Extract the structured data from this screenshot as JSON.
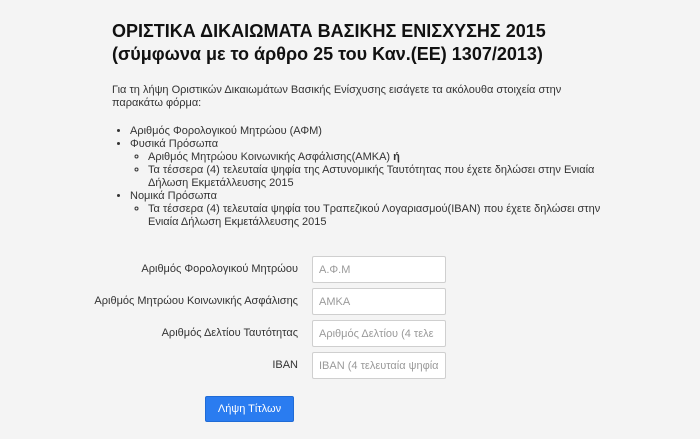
{
  "header": {
    "title_line1": "ΟΡΙΣΤΙΚΑ ΔΙΚΑΙΩΜΑΤΑ ΒΑΣΙΚΗΣ ΕΝΙΣΧΥΣΗΣ 2015",
    "title_line2": "(σύμφωνα με το άρθρο 25 του Καν.(ΕΕ) 1307/2013)"
  },
  "intro": {
    "text": "Για τη λήψη Οριστικών Δικαιωμάτων Βασικής Ενίσχυσης εισάγετε τα ακόλουθα στοιχεία στην παρακάτω φόρμα:"
  },
  "requirements": {
    "afm": "Αριθμός Φορολογικού Μητρώου (ΑΦΜ)",
    "natural_persons": {
      "label": "Φυσικά Πρόσωπα",
      "amka_text": "Αριθμός Μητρώου Κοινωνικής Ασφάλισης(ΑΜΚΑ)",
      "or_text": "ή",
      "id_card_text": "Τα τέσσερα (4) τελευταία ψηφία της Αστυνομικής Ταυτότητας που έχετε δηλώσει στην Ενιαία Δήλωση Εκμετάλλευσης 2015"
    },
    "legal_persons": {
      "label": "Νομικά Πρόσωπα",
      "iban_text": "Τα τέσσερα (4) τελευταία ψηφία του Τραπεζικού Λογαριασμού(IBAN) που έχετε δηλώσει στην Ενιαία Δήλωση Εκμετάλλευσης 2015"
    }
  },
  "form": {
    "afm": {
      "label": "Αριθμός Φορολογικού Μητρώου",
      "placeholder": "Α.Φ.Μ",
      "value": ""
    },
    "amka": {
      "label": "Αριθμός Μητρώου Κοινωνικής Ασφάλισης",
      "placeholder": "ΑΜΚΑ",
      "value": ""
    },
    "id_card": {
      "label": "Αριθμός Δελτίου Ταυτότητας",
      "placeholder": "Αριθμός Δελτίου (4 τελε",
      "value": ""
    },
    "iban": {
      "label": "IBAN",
      "placeholder": "IBAN (4 τελευταία ψηφία",
      "value": ""
    },
    "submit_label": "Λήψη Τίτλων"
  },
  "colors": {
    "background": "#f4f4f4",
    "button_background": "#2a7cf0",
    "button_text": "#ffffff"
  }
}
